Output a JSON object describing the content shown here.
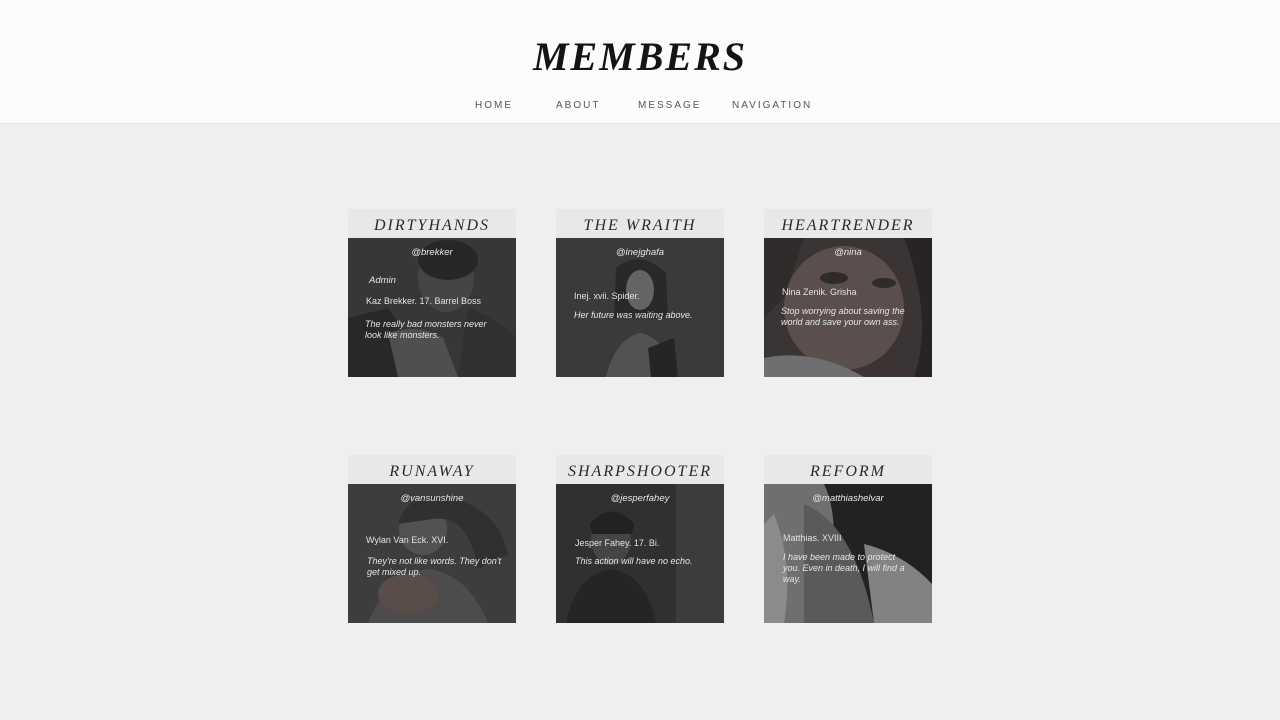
{
  "header": {
    "title": "MEMBERS",
    "nav": [
      "HOME",
      "ABOUT",
      "MESSAGE",
      "NAVIGATION"
    ]
  },
  "members": [
    {
      "name": "DIRTYHANDS",
      "handle": "@brekker",
      "role": "Admin",
      "info": "Kaz Brekker. 17. Barrel Boss",
      "quote": "The really bad monsters never look like monsters."
    },
    {
      "name": "THE WRAITH",
      "handle": "@inejghafa",
      "info": "Inej. xvii. Spider.",
      "quote": "Her future was waiting above."
    },
    {
      "name": "HEARTRENDER",
      "handle": "@nina",
      "info": "Nina Zenik. Grisha",
      "quote": "Stop worrying about saving the world and save your own ass."
    },
    {
      "name": "RUNAWAY",
      "handle": "@vansunshine",
      "info": "Wylan Van Eck. XVI.",
      "quote": "They're not like words. They don't get mixed up."
    },
    {
      "name": "SHARPSHOOTER",
      "handle": "@jesperfahey",
      "info": "Jesper Fahey. 17. Bi.",
      "quote": "This action will have no echo."
    },
    {
      "name": "REFORM",
      "handle": "@matthiashelvar",
      "info": "Matthias. XVIII",
      "quote": "I have been made to protect you. Even in death, I will find a way."
    }
  ]
}
